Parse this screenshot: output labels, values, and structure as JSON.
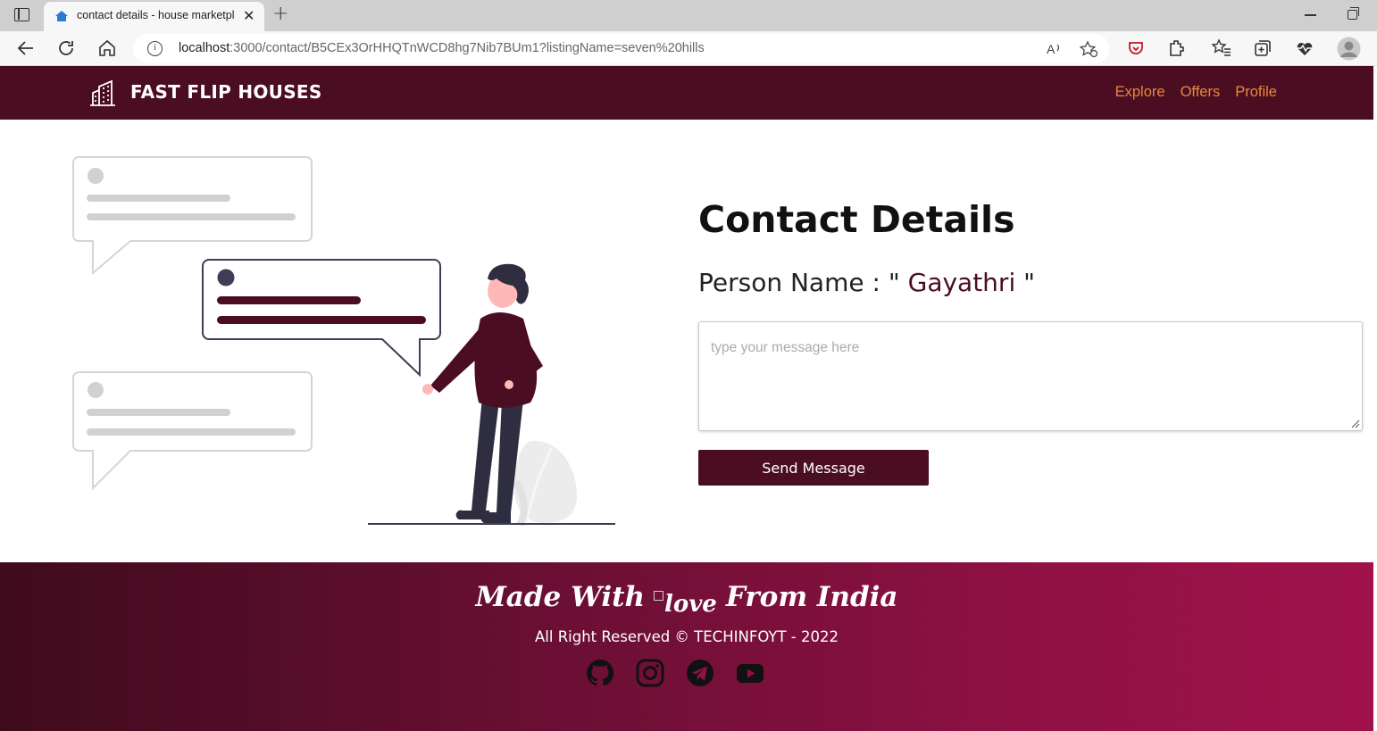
{
  "browser": {
    "tab_title": "contact details - house marketpl",
    "url_host": "localhost",
    "url_rest": ":3000/contact/B5CEx3OrHHQTnWCD8hg7Nib7BUm1?listingName=seven%20hills"
  },
  "header": {
    "brand": "FAST FLIP HOUSES",
    "nav": [
      "Explore",
      "Offers",
      "Profile"
    ]
  },
  "main": {
    "title": "Contact Details",
    "person_label": "Person Name : \"",
    "person_name": " Gayathri ",
    "person_close": "\"",
    "message_placeholder": "type your message here",
    "send_label": "Send Message"
  },
  "footer": {
    "made_prefix": "Made With",
    "love_alt": "love",
    "made_suffix": "From India",
    "rights": "All Right Reserved © TECHINFOYT - 2022"
  },
  "colors": {
    "brand": "#4b0d22",
    "nav_link": "#e58a3a",
    "footer_start": "#3f0b1c",
    "footer_end": "#a0124c"
  },
  "icons": [
    "github-icon",
    "instagram-icon",
    "telegram-icon",
    "youtube-icon"
  ]
}
